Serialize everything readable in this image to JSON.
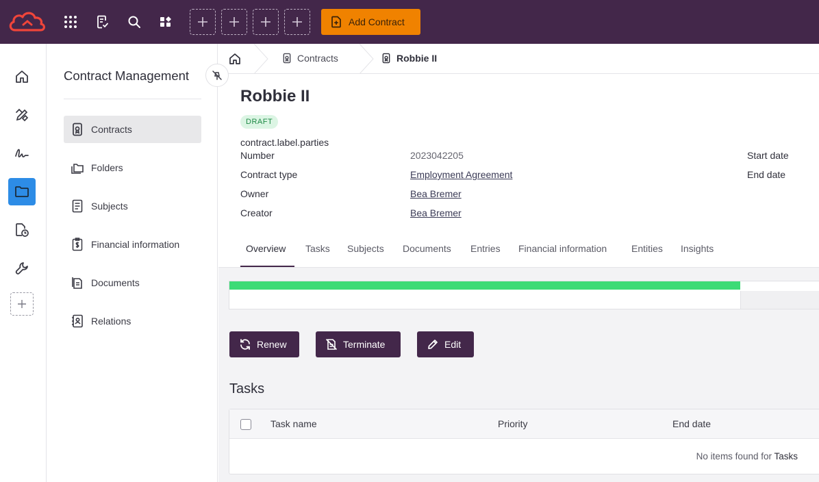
{
  "topbar": {
    "icons": [
      "apps-grid-icon",
      "document-check-icon",
      "search-icon",
      "widgets-icon"
    ],
    "add_contract_label": "Add Contract"
  },
  "rail": {
    "items": [
      "home-icon",
      "design-tools-icon",
      "signature-icon",
      "folder-icon",
      "document-clock-icon",
      "wrench-icon"
    ],
    "active_index": 3
  },
  "sidebar": {
    "title": "Contract Management",
    "items": [
      {
        "label": "Contracts",
        "icon": "contract-icon"
      },
      {
        "label": "Folders",
        "icon": "folders-icon"
      },
      {
        "label": "Subjects",
        "icon": "subjects-icon"
      },
      {
        "label": "Financial information",
        "icon": "financial-icon"
      },
      {
        "label": "Documents",
        "icon": "documents-icon"
      },
      {
        "label": "Relations",
        "icon": "relations-icon"
      }
    ],
    "active_index": 0
  },
  "breadcrumb": {
    "items": [
      "Contracts",
      "Robbie II"
    ]
  },
  "contract": {
    "title": "Robbie II",
    "status": "DRAFT",
    "parties_label": "contract.label.parties",
    "fields": [
      {
        "label": "Number",
        "value": "2023042205"
      },
      {
        "label": "Contract type",
        "value": "Employment Agreement"
      },
      {
        "label": "Owner",
        "value": "Bea Bremer"
      },
      {
        "label": "Creator",
        "value": "Bea Bremer"
      }
    ],
    "right_labels": [
      "Start date",
      "End date"
    ]
  },
  "tabs": [
    "Overview",
    "Tasks",
    "Subjects",
    "Documents",
    "Entries",
    "Financial information",
    "Entities",
    "Insights"
  ],
  "active_tab": 0,
  "progress": {
    "fraction": 0.85,
    "color": "#3ddb76"
  },
  "actions": {
    "renew": "Renew",
    "terminate": "Terminate",
    "edit": "Edit"
  },
  "tasks": {
    "title": "Tasks",
    "columns": [
      "Task name",
      "Priority",
      "End date"
    ],
    "empty_prefix": "No items found for",
    "empty_entity": "Tasks"
  },
  "colors": {
    "topbar": "#43274a",
    "accent": "#f08200",
    "active_rail": "#2d8ce6",
    "button": "#43274a"
  }
}
